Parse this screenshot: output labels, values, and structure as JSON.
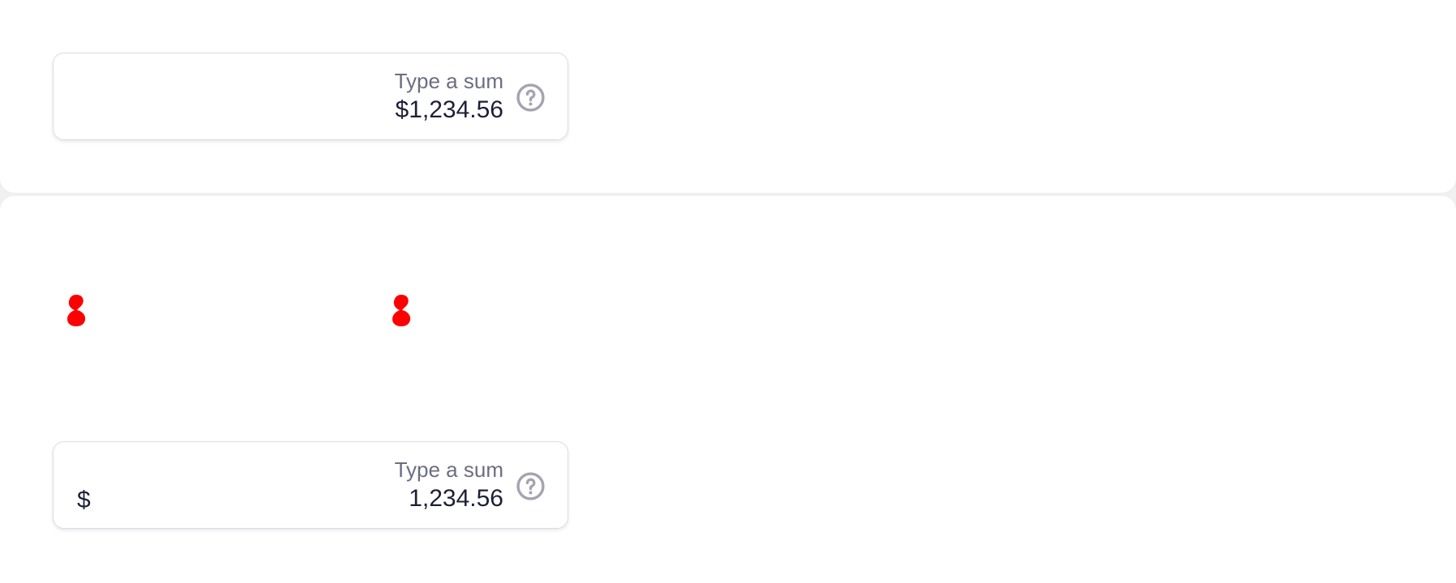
{
  "currency_fields": [
    {
      "label": "Type a sum",
      "value": "$1,234.56",
      "prefix": "",
      "help_icon": "question-circle-icon"
    },
    {
      "label": "Type a sum",
      "value": "1,234.56",
      "prefix": "$",
      "help_icon": "question-circle-icon"
    }
  ],
  "colors": {
    "text_primary": "#1c1f38",
    "text_label": "#6b6e82",
    "icon_gray": "#a3a4b0",
    "field_border": "#dcdee4",
    "marker_red": "#ff0000"
  }
}
